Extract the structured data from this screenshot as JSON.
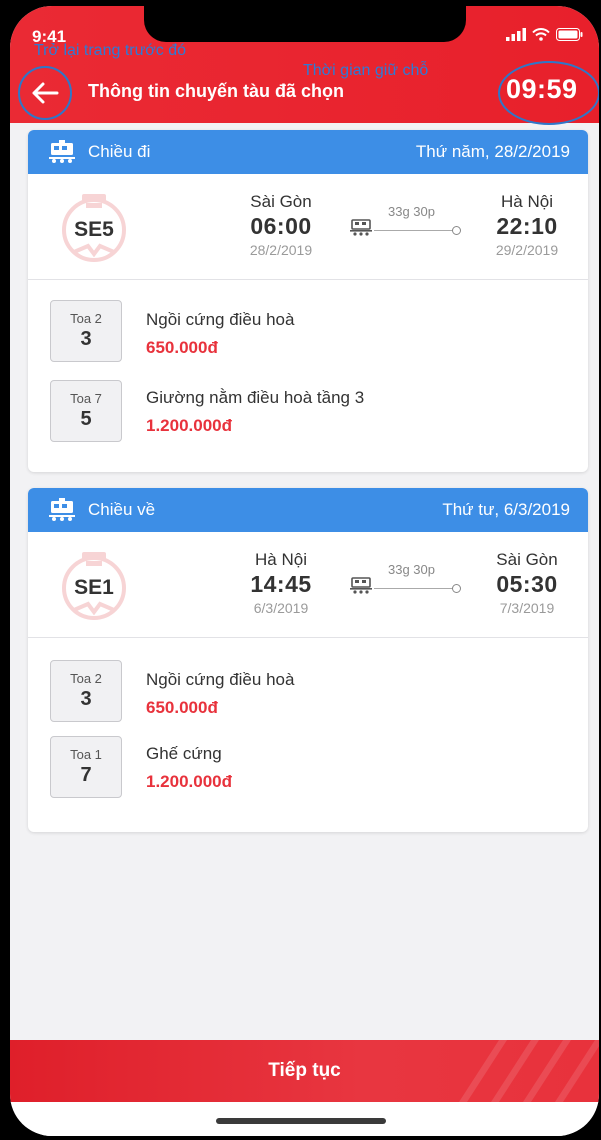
{
  "status_bar": {
    "time": "9:41"
  },
  "annotations": {
    "back_hint": "Trở lại trang trước đó",
    "timer_hint": "Thời gian giữ chỗ"
  },
  "header": {
    "title": "Thông tin chuyến tàu đã chọn",
    "timer": "09:59",
    "back_icon": "arrow-left-icon"
  },
  "outbound": {
    "label": "Chiều đi",
    "date": "Thứ năm, 28/2/2019",
    "train": "SE5",
    "from": {
      "name": "Sài Gòn",
      "time": "06:00",
      "date": "28/2/2019"
    },
    "to": {
      "name": "Hà Nội",
      "time": "22:10",
      "date": "29/2/2019"
    },
    "duration": "33g 30p",
    "seats": [
      {
        "car": "Toa 2",
        "num": "3",
        "type": "Ngồi cứng điều hoà",
        "price": "650.000đ"
      },
      {
        "car": "Toa 7",
        "num": "5",
        "type": "Giường nằm điều hoà tầng 3",
        "price": "1.200.000đ"
      }
    ]
  },
  "return": {
    "label": "Chiều về",
    "date": "Thứ tư, 6/3/2019",
    "train": "SE1",
    "from": {
      "name": "Hà Nội",
      "time": "14:45",
      "date": "6/3/2019"
    },
    "to": {
      "name": "Sài Gòn",
      "time": "05:30",
      "date": "7/3/2019"
    },
    "duration": "33g 30p",
    "seats": [
      {
        "car": "Toa 2",
        "num": "3",
        "type": "Ngồi cứng điều hoà",
        "price": "650.000đ"
      },
      {
        "car": "Toa 1",
        "num": "7",
        "type": "Ghế cứng",
        "price": "1.200.000đ"
      }
    ]
  },
  "footer": {
    "continue_label": "Tiếp tục"
  },
  "colors": {
    "brand_red": "#e8202b",
    "card_header_blue": "#3d8ee6",
    "price_red": "#e8323c",
    "annotation_blue": "#2d7bd6"
  }
}
